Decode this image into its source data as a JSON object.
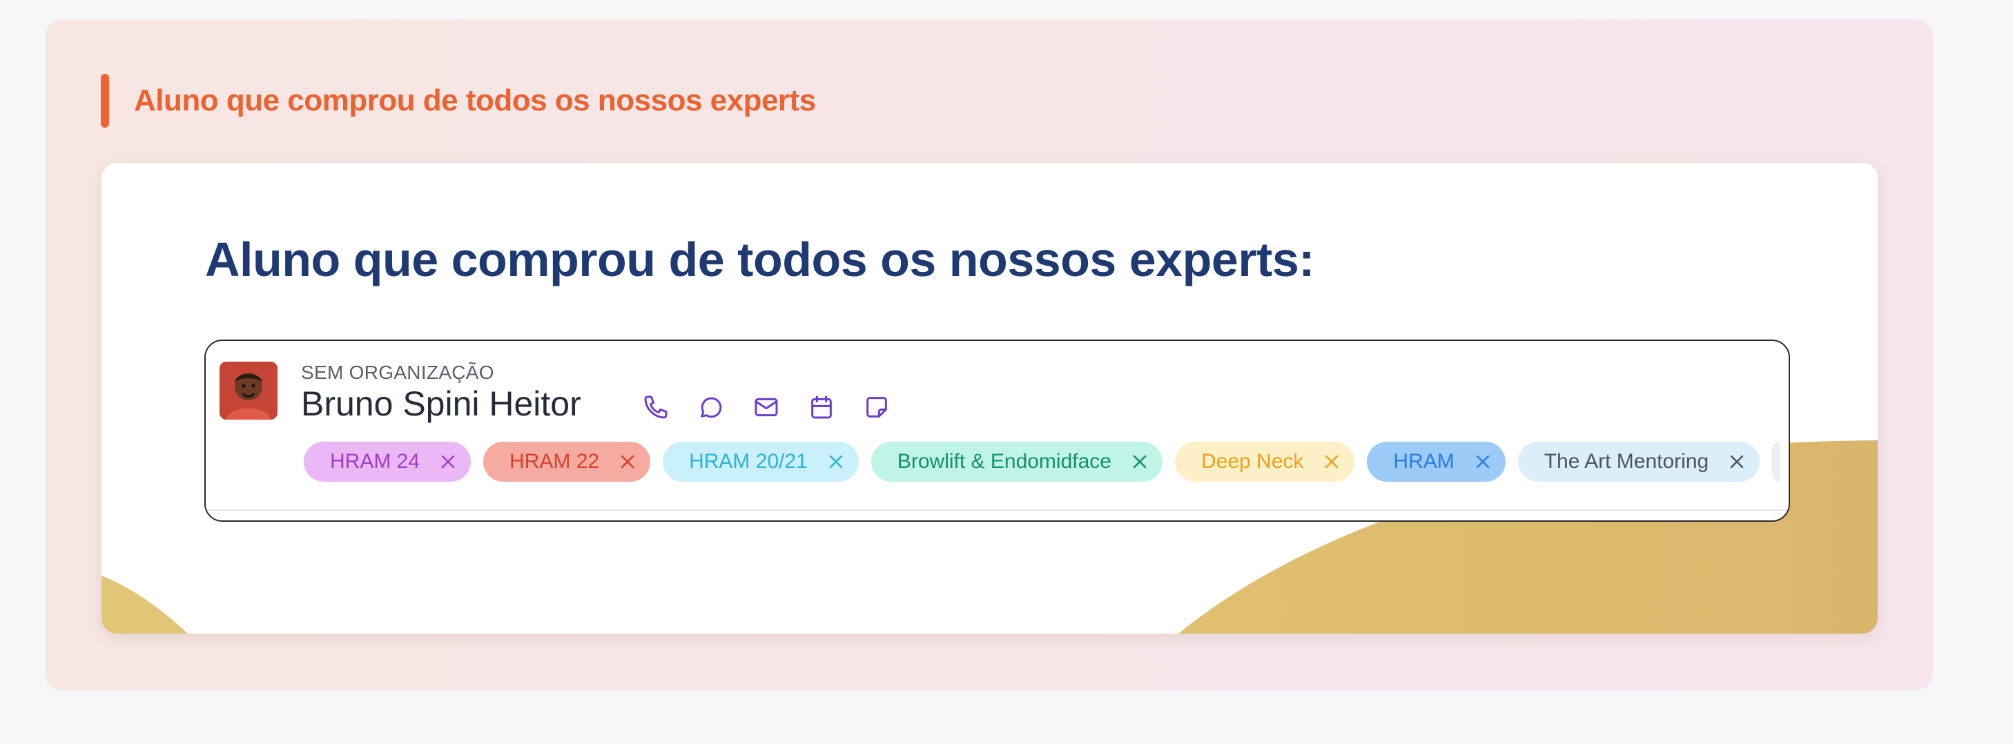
{
  "section": {
    "title": "Aluno que comprou de todos os nossos experts",
    "accent_color": "#ef6232"
  },
  "card": {
    "heading": "Aluno que comprou de todos os nossos experts:",
    "contact": {
      "organization": "SEM ORGANIZAÇÃO",
      "name": "Bruno Spini Heitor",
      "actions": [
        {
          "icon": "phone-icon"
        },
        {
          "icon": "chat-icon"
        },
        {
          "icon": "mail-icon"
        },
        {
          "icon": "calendar-icon"
        },
        {
          "icon": "note-icon"
        }
      ],
      "action_color": "#6a3fd0",
      "tags": [
        {
          "label": "HRAM 24",
          "bg": "#eab8f5",
          "fg": "#a13ec7"
        },
        {
          "label": "HRAM 22",
          "bg": "#f5aba0",
          "fg": "#d8412c"
        },
        {
          "label": "HRAM 20/21",
          "bg": "#c9f0fb",
          "fg": "#2eb3d6"
        },
        {
          "label": "Browlift & Endomidface",
          "bg": "#bff4e6",
          "fg": "#15906d"
        },
        {
          "label": "Deep Neck",
          "bg": "#fdefc6",
          "fg": "#efa01c"
        },
        {
          "label": "HRAM",
          "bg": "#9ccbf7",
          "fg": "#2d7de0"
        },
        {
          "label": "The Art Mentoring",
          "bg": "#dbeefa",
          "fg": "#4a5561"
        }
      ]
    }
  }
}
